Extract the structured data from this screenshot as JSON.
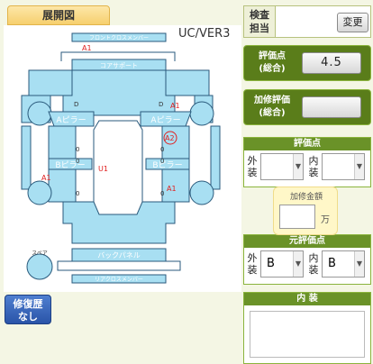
{
  "title_tab": "展開図",
  "model_label": "UC/VER3",
  "repair": {
    "line1": "修復歴",
    "line2": "なし"
  },
  "inspector": {
    "label_line1": "検査",
    "label_line2": "担当",
    "change_button": "変更"
  },
  "evaluation_score": {
    "label_line1": "評価点",
    "label_line2": "(総合)",
    "value": "4.5"
  },
  "repair_evaluation": {
    "label_line1": "加修評価",
    "label_line2": "(総合)",
    "value": ""
  },
  "score_panel": {
    "header": "評価点",
    "exterior_label": [
      "外",
      "装"
    ],
    "exterior_value": "",
    "interior_label": [
      "内",
      "装"
    ],
    "interior_value": ""
  },
  "repair_amount": {
    "label": "加修金額",
    "value": "",
    "unit": "万"
  },
  "original_score_panel": {
    "header": "元評価点",
    "exterior_label": [
      "外",
      "装"
    ],
    "exterior_value": "B",
    "interior_label": [
      "内",
      "装"
    ],
    "interior_value": "B"
  },
  "interior_panel": {
    "header": "内 装",
    "value": ""
  },
  "diagram": {
    "parts": {
      "front_cross_member": "フロントクロスメンバー",
      "core_support": "コアサポート",
      "a_pillar_left": "Aピラー",
      "a_pillar_right": "Aピラー",
      "b_pillar_left": "Bピラー",
      "b_pillar_right": "Bピラー",
      "back_panel": "バックパネル",
      "rear_cross_member": "リアクロスメンバー",
      "spare": "スペア"
    },
    "marks": {
      "a1_top": "A1",
      "a1_right": "A1",
      "a2": "A2",
      "u1": "U1",
      "a1_left": "A1",
      "a1_right_lower": "A1"
    },
    "small_labels": {
      "d1": "D",
      "d2": "D",
      "d3": "0",
      "d4": "0",
      "d5": "0",
      "d6": "0",
      "d7": "0",
      "d8": "0"
    },
    "colors": {
      "panel_fill": "#a8dff2",
      "panel_stroke": "#2a5a7c",
      "mark": "#e02020"
    }
  }
}
